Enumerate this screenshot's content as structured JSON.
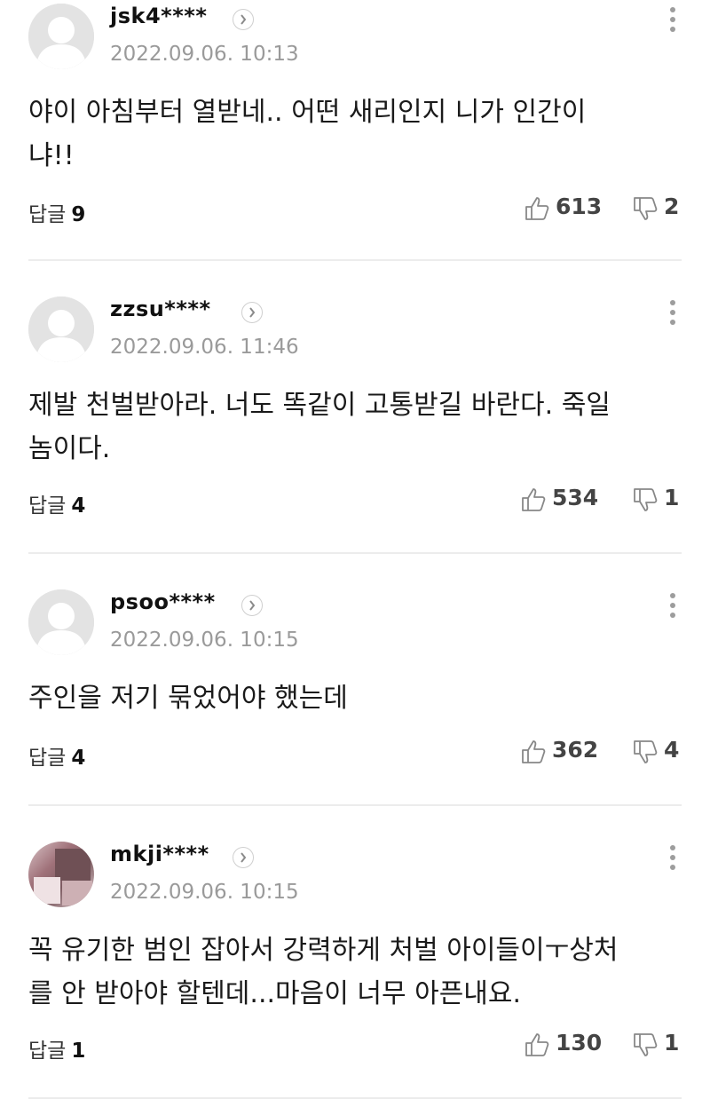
{
  "comments": [
    {
      "username": "jsk4****",
      "timestamp": "2022.09.06. 10:13",
      "text": "야이 아침부터 열받네.. 어떤 새리인지 니가 인간이\n냐!!",
      "reply_label": "답글",
      "reply_count": "9",
      "likes": "613",
      "dislikes": "2",
      "avatar": "default-profile-icon"
    },
    {
      "username": "zzsu****",
      "timestamp": "2022.09.06. 11:46",
      "text": "제발 천벌받아라. 너도 똑같이 고통받길 바란다. 죽일\n놈이다.",
      "reply_label": "답글",
      "reply_count": "4",
      "likes": "534",
      "dislikes": "1",
      "avatar": "default-profile-icon"
    },
    {
      "username": "psoo****",
      "timestamp": "2022.09.06. 10:15",
      "text": "주인을 저기 묶었어야 했는데",
      "reply_label": "답글",
      "reply_count": "4",
      "likes": "362",
      "dislikes": "4",
      "avatar": "default-profile-icon"
    },
    {
      "username": "mkji****",
      "timestamp": "2022.09.06. 10:15",
      "text": "꼭 유기한 범인 잡아서 강력하게 처벌 아이들이ㅜ상처\n를 안 받아야 할텐데...마음이 너무 아픈내요.",
      "reply_label": "답글",
      "reply_count": "1",
      "likes": "130",
      "dislikes": "1",
      "avatar": "blurred-photo"
    }
  ],
  "colors": {
    "text": "#1a1a1a",
    "meta": "#9a9a9a",
    "divider": "#ececec",
    "icon": "#9d9d9d"
  }
}
